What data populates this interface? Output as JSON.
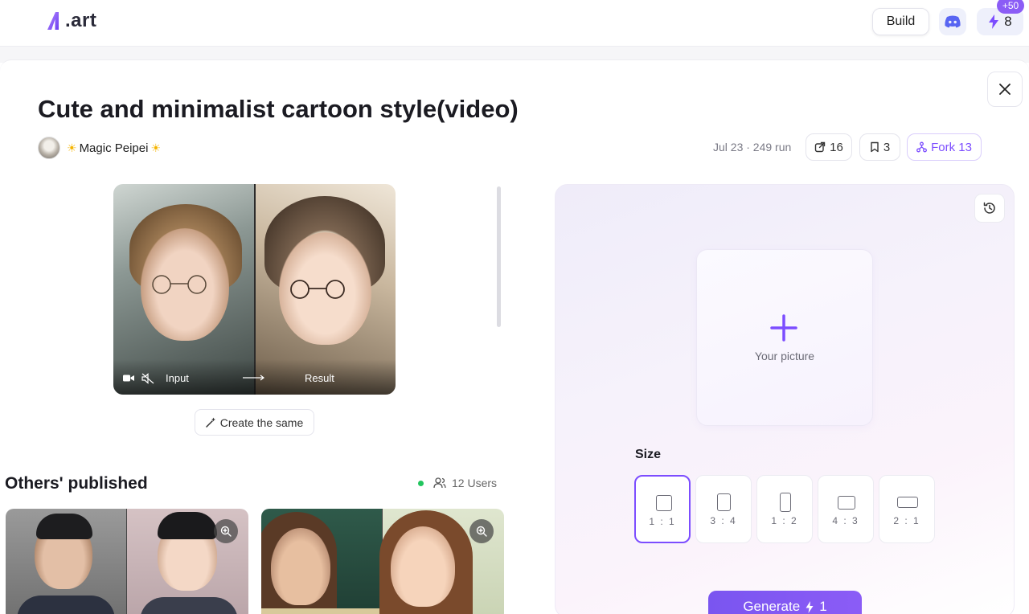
{
  "header": {
    "logo_text": ".art",
    "build_label": "Build",
    "credits": "8",
    "credits_bonus": "+50"
  },
  "workflow": {
    "title": "Cute and minimalist cartoon style(video)",
    "author": "Magic Peipei",
    "meta": "Jul 23 · 249 run",
    "shares": "16",
    "saves": "3",
    "fork_label": "Fork 13"
  },
  "media": {
    "input_label": "Input",
    "result_label": "Result"
  },
  "create_same_label": "Create the same",
  "others": {
    "title": "Others' published",
    "users_label": "12 Users"
  },
  "panel": {
    "upload_label": "Your picture",
    "size_label": "Size",
    "sizes": [
      {
        "label": "1 : 1",
        "selected": true
      },
      {
        "label": "3 : 4",
        "selected": false
      },
      {
        "label": "1 : 2",
        "selected": false
      },
      {
        "label": "4 : 3",
        "selected": false
      },
      {
        "label": "2 : 1",
        "selected": false
      }
    ],
    "generate_label": "Generate",
    "generate_cost": "1"
  },
  "colors": {
    "accent": "#7c4dff",
    "online": "#22c55e",
    "badge": "#8b5cf6"
  }
}
